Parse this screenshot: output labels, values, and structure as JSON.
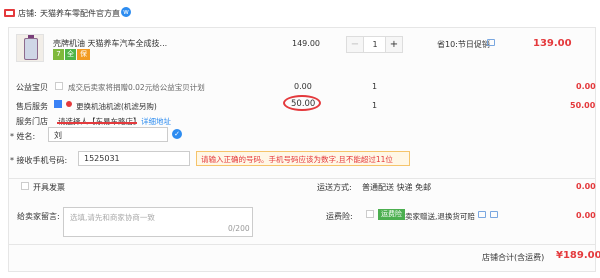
{
  "shop": {
    "label": "店铺:",
    "name": "天猫养车零配件官方直",
    "ww_glyph": "w"
  },
  "product": {
    "title": "壳牌机油 天猫养车汽车全成技...",
    "badges": [
      "7",
      "全",
      "保"
    ],
    "unit_price": "149.00",
    "quantity": "1",
    "minus": "−",
    "plus": "+",
    "promo": "省10:节日促销",
    "subtotal": "139.00"
  },
  "charity": {
    "label": "公益宝贝",
    "text": "成交后卖家将捐赠0.02元给公益宝贝计划",
    "price": "0.00",
    "qty": "1",
    "total": "0.00"
  },
  "service": {
    "label": "售后服务",
    "text": "更换机油机滤(机滤另购)",
    "price": "50.00",
    "qty": "1",
    "total": "50.00"
  },
  "store": {
    "label": "服务门店",
    "value": "请选择人【东易车路店】",
    "link": "详细地址"
  },
  "form": {
    "name_label": "* 姓名:",
    "name_value": "刘",
    "ok_glyph": "✓",
    "phone_label": "* 接收手机号码:",
    "phone_value": "1525031",
    "warning": "请输入正确的号码。手机号码应该为数字,且不能超过11位"
  },
  "invoice": {
    "label": "开具发票",
    "ship_label": "运送方式:",
    "ship_value": "普通配送 快递 免邮",
    "ship_price": "0.00"
  },
  "message": {
    "label": "给卖家留言:",
    "placeholder": "选填,请先和商家协商一致",
    "count": "0/200",
    "insurance_label": "运费险:",
    "insurance_tag": "运费险",
    "insurance_text": "卖家赠送,退换货可赔",
    "insurance_price": "0.00"
  },
  "footer": {
    "total_label": "店铺合计(含运费)",
    "total_value": "¥189.00"
  },
  "colors": {
    "accent_red": "#e4393c",
    "link_blue": "#2d8cf0",
    "warn_bg": "#fff7e6"
  }
}
